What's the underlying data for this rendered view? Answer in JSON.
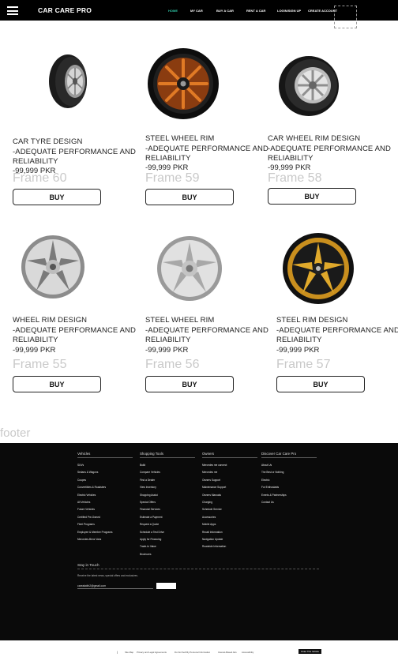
{
  "nav": {
    "brand": "CAR CARE PRO",
    "links": [
      {
        "label": "HOME",
        "active": true
      },
      {
        "label": "MY CAR",
        "active": false
      },
      {
        "label": "BUY A CAR",
        "active": false
      },
      {
        "label": "RENT A CAR",
        "active": false
      },
      {
        "label": "LOGIN/SIGN UP",
        "active": false
      },
      {
        "label": "CREATE ACCOUNT",
        "active": false
      }
    ]
  },
  "products": [
    {
      "title": "CAR TYRE DESIGN\n-ADEQUATE PERFORMANCE AND RELIABILITY",
      "price": "-99,999 PKR",
      "frame": "Frame 60",
      "buy": "BUY",
      "image": "tyre-icon"
    },
    {
      "title": "STEEL WHEEL RIM\n-ADEQUATE PERFORMANCE AND RELIABILITY",
      "price": "-99,999 PKR",
      "frame": "Frame 59",
      "buy": "BUY",
      "image": "orange-rim-icon"
    },
    {
      "title": "CAR WHEEL RIM DESIGN\n-ADEQUATE PERFORMANCE AND RELIABILITY",
      "price": "-99,999 PKR",
      "frame": "Frame 58",
      "buy": "BUY",
      "image": "wheel-icon"
    },
    {
      "title": "WHEEL RIM DESIGN\n-ADEQUATE PERFORMANCE AND RELIABILITY",
      "price": "-99,999 PKR",
      "frame": "Frame 55",
      "buy": "BUY",
      "image": "silver-rim-icon"
    },
    {
      "title": "STEEL WHEEL RIM\n-ADEQUATE PERFORMANCE AND RELIABILITY",
      "price": "-99,999 PKR",
      "frame": "Frame 56",
      "buy": "BUY",
      "image": "steel-rim-icon"
    },
    {
      "title": "STEEL RIM DESIGN\n-ADEQUATE PERFORMANCE AND RELIABILITY",
      "price": "-99,999 PKR",
      "frame": "Frame 57",
      "buy": "BUY",
      "image": "gold-rim-icon"
    }
  ],
  "footer_label": "footer",
  "footer": {
    "columns": [
      {
        "heading": "Vehicles",
        "items": [
          "SUVs",
          "Sedans & Wagons",
          "Coupes",
          "Convertibles & Roadsters",
          "Electric Vehicles",
          "All Vehicles",
          "Future Vehicles",
          "Certified Pre-Owned",
          "Fleet Programs",
          "Employee & Member Programs",
          "Mercedes-Benz Vans"
        ]
      },
      {
        "heading": "Shopping Tools",
        "items": [
          "Build",
          "Compare Vehicles",
          "Find a Dealer",
          "View Inventory",
          "Shopping Assist",
          "Special Offers",
          "Financial Services",
          "Estimate a Payment",
          "Request a Quote",
          "Schedule a Test Drive",
          "Apply for Financing",
          "Trade-In Value",
          "Brochures"
        ]
      },
      {
        "heading": "Owners",
        "items": [
          "Mercedes me connect",
          "Mercedes me",
          "Owners Support",
          "Maintenance Support",
          "Owners Manuals",
          "Charging",
          "Schedule Service",
          "Accessories",
          "Mobile Apps",
          "Recall Information",
          "Navigation Update",
          "Roadside Information"
        ]
      },
      {
        "heading": "Discover Car Care Pro",
        "items": [
          "About Us",
          "The Best or Nothing",
          "Electric",
          "For Enthusiasts",
          "Events & Partnerships",
          "Contact Us"
        ]
      }
    ],
    "stay": {
      "heading": "Stay in Touch",
      "desc": "Receive the latest news, special offers and exclusives.",
      "email_value": "carealwith2@gmail.com"
    },
    "signup_label": ""
  },
  "bottom": {
    "links": [
      "Site Map",
      "Privacy and Legal Agreements",
      "Do Not Sell My Personal Information",
      "Interest-Based Ads",
      "Accessibility"
    ],
    "button": "Order This Vehicle"
  },
  "colors": {
    "nav_bg": "#000000",
    "active_link": "#2ec4a4",
    "footer_bg": "#0a0a0a",
    "frame_label": "#c9c9c9"
  }
}
